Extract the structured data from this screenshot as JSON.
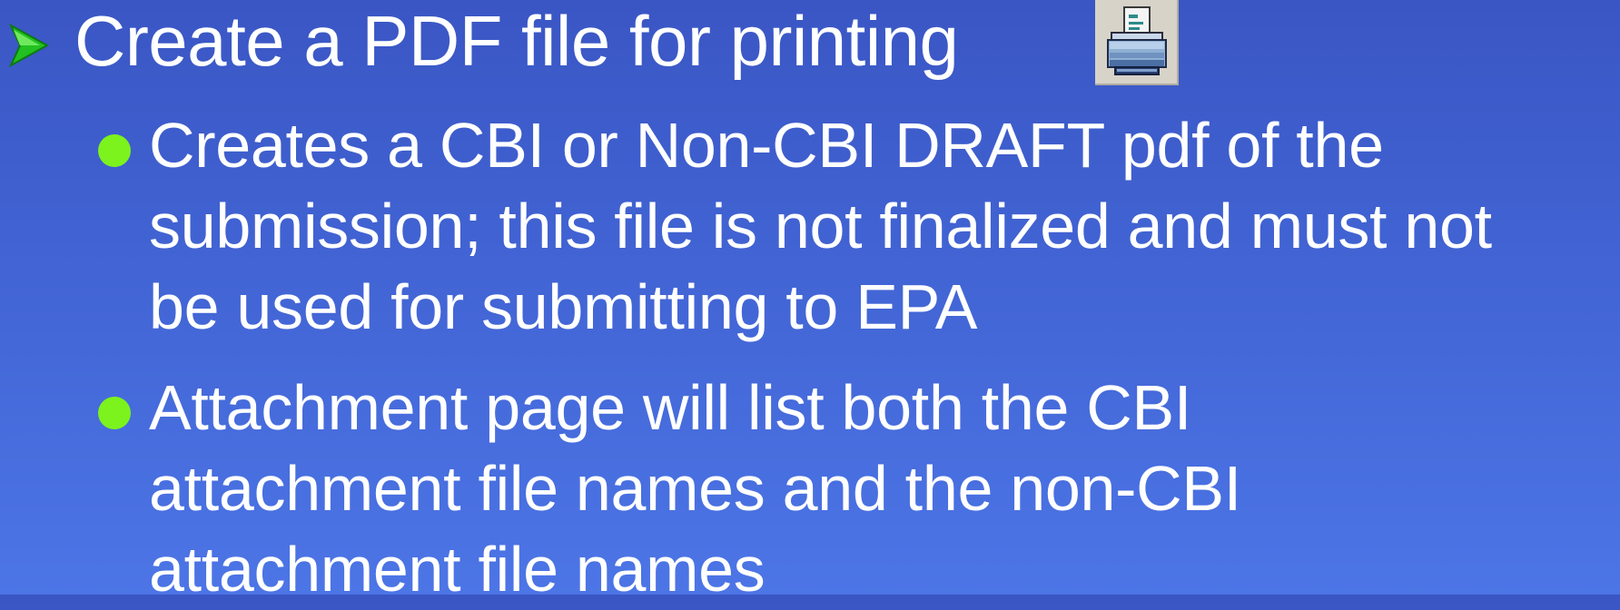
{
  "slide": {
    "heading": {
      "bullet_icon": "green-arrow-bullet",
      "text": "Create a PDF file for printing",
      "icon": "printer-icon"
    },
    "bullets": [
      {
        "bullet_color": "#7cf31c",
        "lines": [
          "Creates a CBI or Non-CBI DRAFT pdf of the",
          "submission; this file is not finalized and must not",
          "be used for submitting to EPA"
        ]
      },
      {
        "bullet_color": "#7cf31c",
        "lines": [
          "Attachment page will list both the CBI",
          "attachment file names and the non-CBI",
          "attachment file names"
        ]
      }
    ]
  },
  "colors": {
    "background_top": "#3a56c4",
    "background_bottom": "#4c75e6",
    "text": "#ffffff",
    "arrow_bullet": "#22c020"
  }
}
